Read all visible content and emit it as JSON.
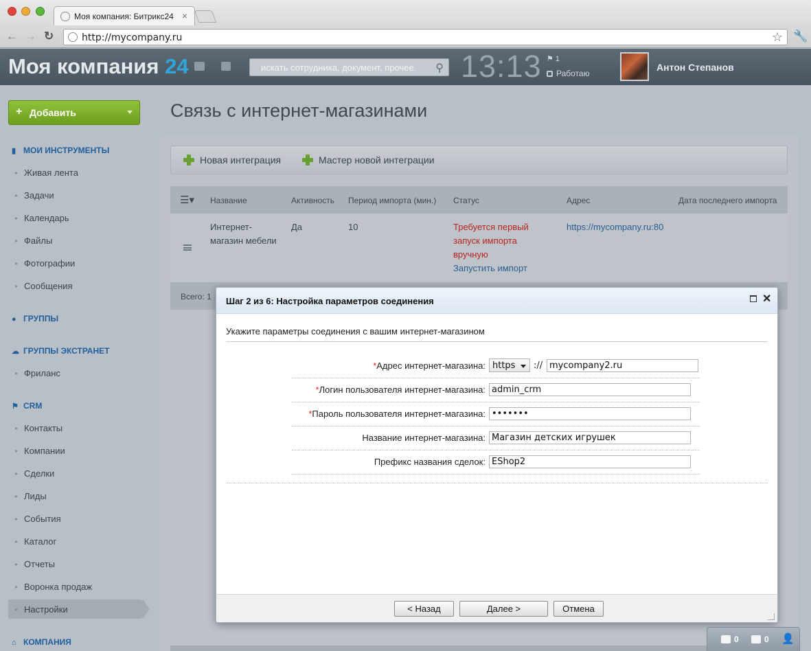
{
  "browser": {
    "tab_title": "Моя компания: Битрикс24",
    "url": "http://mycompany.ru"
  },
  "header": {
    "logo_text": "Моя компания",
    "logo_num": "24",
    "search_placeholder": "искать сотрудника, документ, прочее.",
    "clock": "13:13",
    "flag_count": "1",
    "status": "Работаю",
    "user_name": "Антон Степанов"
  },
  "sidebar": {
    "add_label": "Добавить",
    "sections": {
      "tools": "МОИ ИНСТРУМЕНТЫ",
      "groups": "ГРУППЫ",
      "extranet": "ГРУППЫ ЭКСТРАНЕТ",
      "crm": "CRM",
      "company": "КОМПАНИЯ"
    },
    "tools_items": [
      "Живая лента",
      "Задачи",
      "Календарь",
      "Файлы",
      "Фотографии",
      "Сообщения"
    ],
    "extranet_items": [
      "Фриланс"
    ],
    "crm_items": [
      "Контакты",
      "Компании",
      "Сделки",
      "Лиды",
      "События",
      "Каталог",
      "Отчеты",
      "Воронка продаж",
      "Настройки"
    ]
  },
  "main": {
    "title": "Связь с интернет-магазинами",
    "toolbar": {
      "new_integration": "Новая интеграция",
      "wizard": "Мастер новой интеграции"
    },
    "grid": {
      "columns": [
        "Название",
        "Активность",
        "Период импорта (мин.)",
        "Статус",
        "Адрес",
        "Дата последнего импорта"
      ],
      "row": {
        "name_line1": "Интернет-",
        "name_line2": "магазин мебели",
        "active": "Да",
        "period": "10",
        "status_line1": "Требуется первый",
        "status_line2": "запуск импорта",
        "status_line3": "вручную",
        "run_import": "Запустить импорт",
        "address": "https://mycompany.ru:80"
      },
      "total": "Всего: 1"
    }
  },
  "dialog": {
    "title": "Шаг 2 из 6: Настройка параметров соединения",
    "subtitle": "Укажите параметры соединения с вашим интернет-магазином",
    "fields": {
      "address_label": "Адрес интернет-магазина:",
      "protocol": "https",
      "protocol_sep": "://",
      "host": "mycompany2.ru",
      "login_label": "Логин пользователя интернет-магазина:",
      "login": "admin_crm",
      "password_label": "Пароль пользователя интернет-магазина:",
      "password": "•••••••",
      "shop_name_label": "Название интернет-магазина:",
      "shop_name": "Магазин детских игрушек",
      "prefix_label": "Префикс названия сделок:",
      "prefix": "EShop2"
    },
    "required_mark": "*",
    "buttons": {
      "back": "< Назад",
      "next": "Далее  >",
      "cancel": "Отмена"
    }
  },
  "widget": {
    "messages": "0",
    "notifications": "0"
  }
}
